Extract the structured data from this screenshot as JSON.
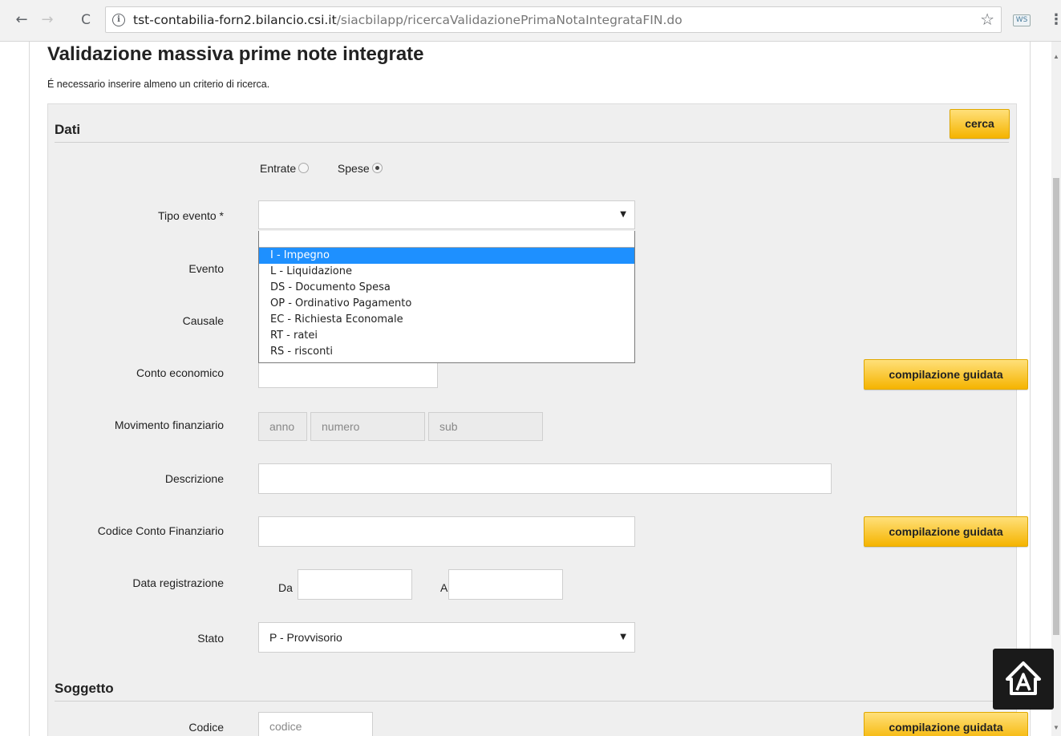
{
  "browser": {
    "back_glyph": "←",
    "forward_glyph": "→",
    "reload_glyph": "C",
    "info_glyph": "i",
    "url_host": "tst-contabilia-forn2.bilancio.csi.it",
    "url_path": "/siacbilapp/ricercaValidazionePrimaNotaIntegrataFIN.do",
    "star_glyph": "☆",
    "extension_label": "WS",
    "menu_glyph": "⋮"
  },
  "page": {
    "title": "Validazione massiva prime note integrate",
    "note": "É necessario inserire almeno un criterio di ricerca."
  },
  "dati": {
    "title": "Dati",
    "search_button": "cerca",
    "radio_entrate": "Entrate",
    "radio_spese": "Spese",
    "selected_radio": "Spese",
    "tipo_evento": {
      "label": "Tipo evento *",
      "value": ""
    },
    "evento_label": "Evento",
    "causale_label": "Causale",
    "conto_economico": {
      "label": "Conto economico",
      "value": "",
      "button": "compilazione guidata"
    },
    "movimento": {
      "label": "Movimento finanziario",
      "anno_placeholder": "anno",
      "numero_placeholder": "numero",
      "sub_placeholder": "sub"
    },
    "descrizione": {
      "label": "Descrizione",
      "value": ""
    },
    "codice_conto": {
      "label": "Codice Conto Finanziario",
      "value": "",
      "button": "compilazione guidata"
    },
    "data_registrazione": {
      "label": "Data registrazione",
      "da_label": "Da",
      "a_label": "A"
    },
    "stato": {
      "label": "Stato",
      "value": "P - Provvisorio"
    }
  },
  "dropdown": {
    "options": [
      "I - Impegno",
      "L - Liquidazione",
      "DS - Documento Spesa",
      "OP - Ordinativo Pagamento",
      "EC - Richiesta Economale",
      "RT - ratei",
      "RS - risconti"
    ],
    "highlighted": "I - Impegno"
  },
  "soggetto": {
    "title": "Soggetto",
    "codice": {
      "label": "Codice",
      "placeholder": "codice",
      "button": "compilazione guidata"
    }
  },
  "colors": {
    "button_yellow": "#f5b400",
    "highlight": "#1e90ff",
    "panel": "#efefef"
  },
  "icons": [
    "back-arrow-icon",
    "forward-arrow-icon",
    "reload-icon",
    "info-icon",
    "star-icon",
    "extension-icon",
    "menu-icon",
    "accessibility-icon",
    "dropdown-caret-icon"
  ]
}
